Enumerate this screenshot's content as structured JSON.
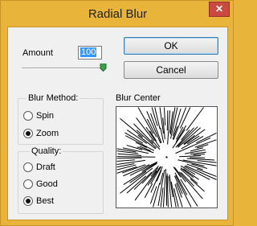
{
  "window": {
    "title": "Radial Blur",
    "close_glyph": "✕"
  },
  "amount": {
    "label": "Amount",
    "value": "100"
  },
  "buttons": {
    "ok": "OK",
    "cancel": "Cancel"
  },
  "blur_method": {
    "legend": "Blur Method:",
    "options": [
      {
        "label": "Spin",
        "checked": false
      },
      {
        "label": "Zoom",
        "checked": true
      }
    ]
  },
  "quality": {
    "legend": "Quality:",
    "options": [
      {
        "label": "Draft",
        "checked": false
      },
      {
        "label": "Good",
        "checked": false
      },
      {
        "label": "Best",
        "checked": true
      }
    ]
  },
  "blur_center": {
    "label": "Blur Center"
  },
  "colors": {
    "titlebar": "#e9b43a",
    "close": "#c94a3f",
    "selection": "#3399ff"
  }
}
